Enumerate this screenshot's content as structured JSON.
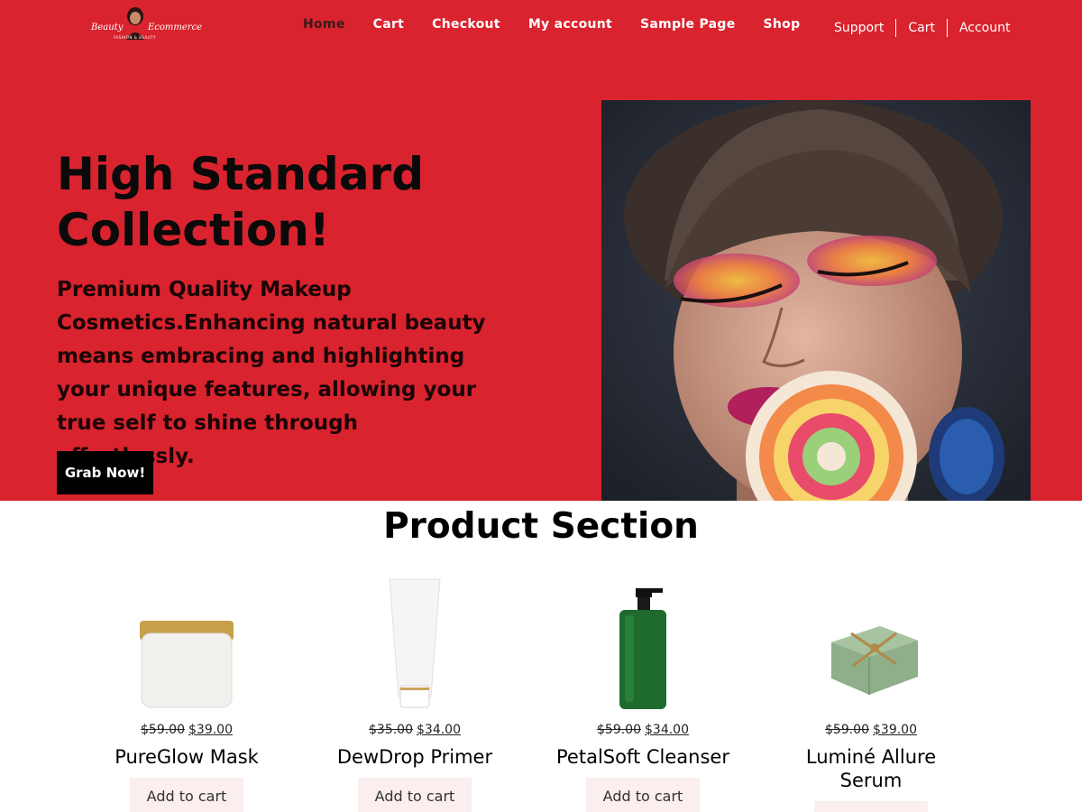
{
  "header": {
    "logo": {
      "word1": "Beauty",
      "word2": "Ecommerce",
      "tagline": "FASHION & BEAUTY"
    },
    "nav": [
      "Home",
      "Cart",
      "Checkout",
      "My account",
      "Sample Page",
      "Shop"
    ],
    "active_nav": "Home",
    "util_nav": [
      "Support",
      "Cart",
      "Account"
    ]
  },
  "hero": {
    "title": "High Standard Collection!",
    "text": "Premium Quality Makeup Cosmetics.Enhancing natural beauty means embracing and highlighting your unique features, allowing your true self to shine through effortlessly.",
    "button": "Grab Now!"
  },
  "products_section": {
    "title": "Product Section",
    "items": [
      {
        "name": "PureGlow Mask",
        "old_price": "$59.00",
        "new_price": "$39.00",
        "button": "Add to cart"
      },
      {
        "name": "DewDrop Primer",
        "old_price": "$35.00",
        "new_price": "$34.00",
        "button": "Add to cart"
      },
      {
        "name": "PetalSoft Cleanser",
        "old_price": "$59.00",
        "new_price": "$34.00",
        "button": "Add to cart"
      },
      {
        "name": "Luminé Allure Serum",
        "old_price": "$59.00",
        "new_price": "$39.00",
        "button": "Add to cart"
      }
    ]
  },
  "colors": {
    "hero_bg": "#d9232e",
    "button_bg": "#000000",
    "cart_button_bg": "#fbeeee"
  }
}
